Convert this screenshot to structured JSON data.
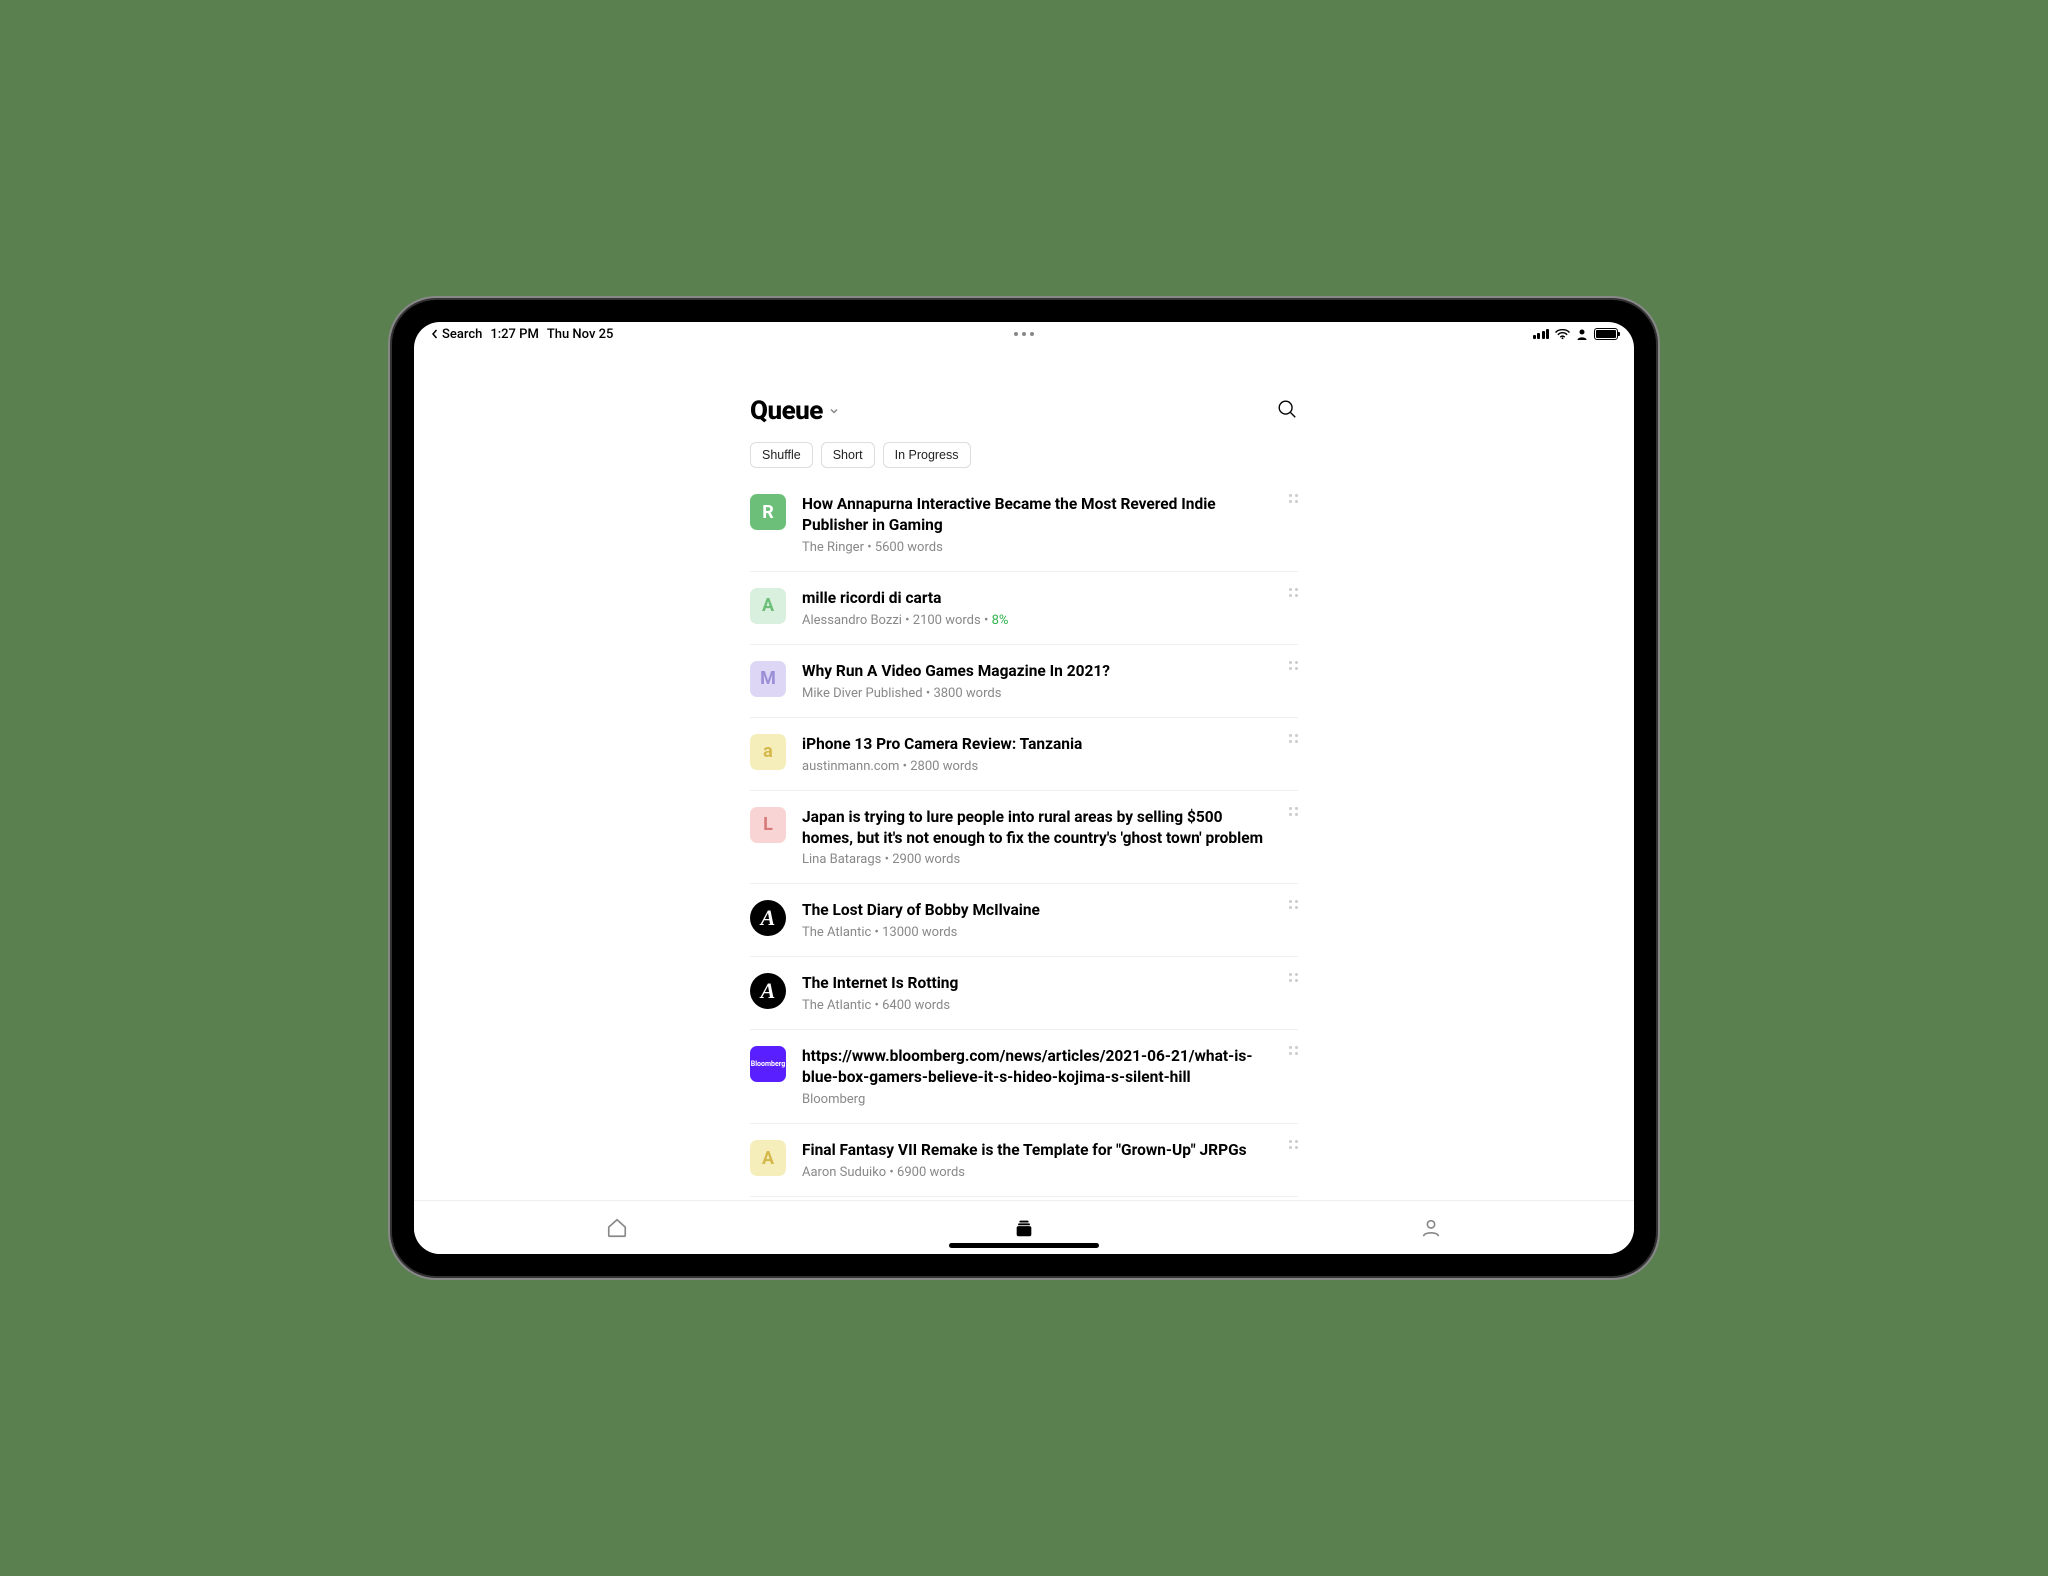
{
  "statusBar": {
    "backLabel": "Search",
    "time": "1:27 PM",
    "date": "Thu Nov 25"
  },
  "header": {
    "title": "Queue"
  },
  "filters": [
    {
      "label": "Shuffle"
    },
    {
      "label": "Short"
    },
    {
      "label": "In Progress"
    }
  ],
  "articles": [
    {
      "title": "How Annapurna Interactive Became the Most Revered Indie Publisher in Gaming",
      "source": "The Ringer",
      "words": "5600 words",
      "progress": "",
      "icon": {
        "type": "letter",
        "letter": "R",
        "bg": "#6cbf78",
        "fg": "#ffffff",
        "badge": true
      }
    },
    {
      "title": "mille ricordi di carta",
      "source": "Alessandro Bozzi",
      "words": "2100 words",
      "progress": "8%",
      "icon": {
        "type": "letter",
        "letter": "A",
        "bg": "#d9f0de",
        "fg": "#6cbf78"
      }
    },
    {
      "title": "Why Run A Video Games Magazine In 2021?",
      "source": "Mike Diver Published",
      "words": "3800 words",
      "progress": "",
      "icon": {
        "type": "letter",
        "letter": "M",
        "bg": "#ddd6f5",
        "fg": "#9a8fd6"
      }
    },
    {
      "title": "iPhone 13 Pro Camera Review: Tanzania",
      "source": "austinmann.com",
      "words": "2800 words",
      "progress": "",
      "icon": {
        "type": "letter",
        "letter": "a",
        "bg": "#f5eebb",
        "fg": "#d5b84a"
      }
    },
    {
      "title": "Japan is trying to lure people into rural areas by selling $500 homes, but it's not enough to fix the country's 'ghost town' problem",
      "source": "Lina Batarags",
      "words": "2900 words",
      "progress": "",
      "icon": {
        "type": "letter",
        "letter": "L",
        "bg": "#f8d4d4",
        "fg": "#d77a7a"
      }
    },
    {
      "title": "The Lost Diary of Bobby McIlvaine",
      "source": "The Atlantic",
      "words": "13000 words",
      "progress": "",
      "icon": {
        "type": "atlantic"
      }
    },
    {
      "title": "The Internet Is Rotting",
      "source": "The Atlantic",
      "words": "6400 words",
      "progress": "",
      "icon": {
        "type": "atlantic"
      }
    },
    {
      "title": "https://www.bloomberg.com/news/articles/2021-06-21/what-is-blue-box-gamers-believe-it-s-hideo-kojima-s-silent-hill",
      "source": "Bloomberg",
      "words": "",
      "progress": "",
      "icon": {
        "type": "bloomberg",
        "label": "Bloomberg"
      }
    },
    {
      "title": "Final Fantasy VII Remake is the Template for \"Grown-Up\" JRPGs",
      "source": "Aaron Suduiko",
      "words": "6900 words",
      "progress": "",
      "icon": {
        "type": "letter",
        "letter": "A",
        "bg": "#f5eebb",
        "fg": "#d5b84a"
      }
    }
  ]
}
